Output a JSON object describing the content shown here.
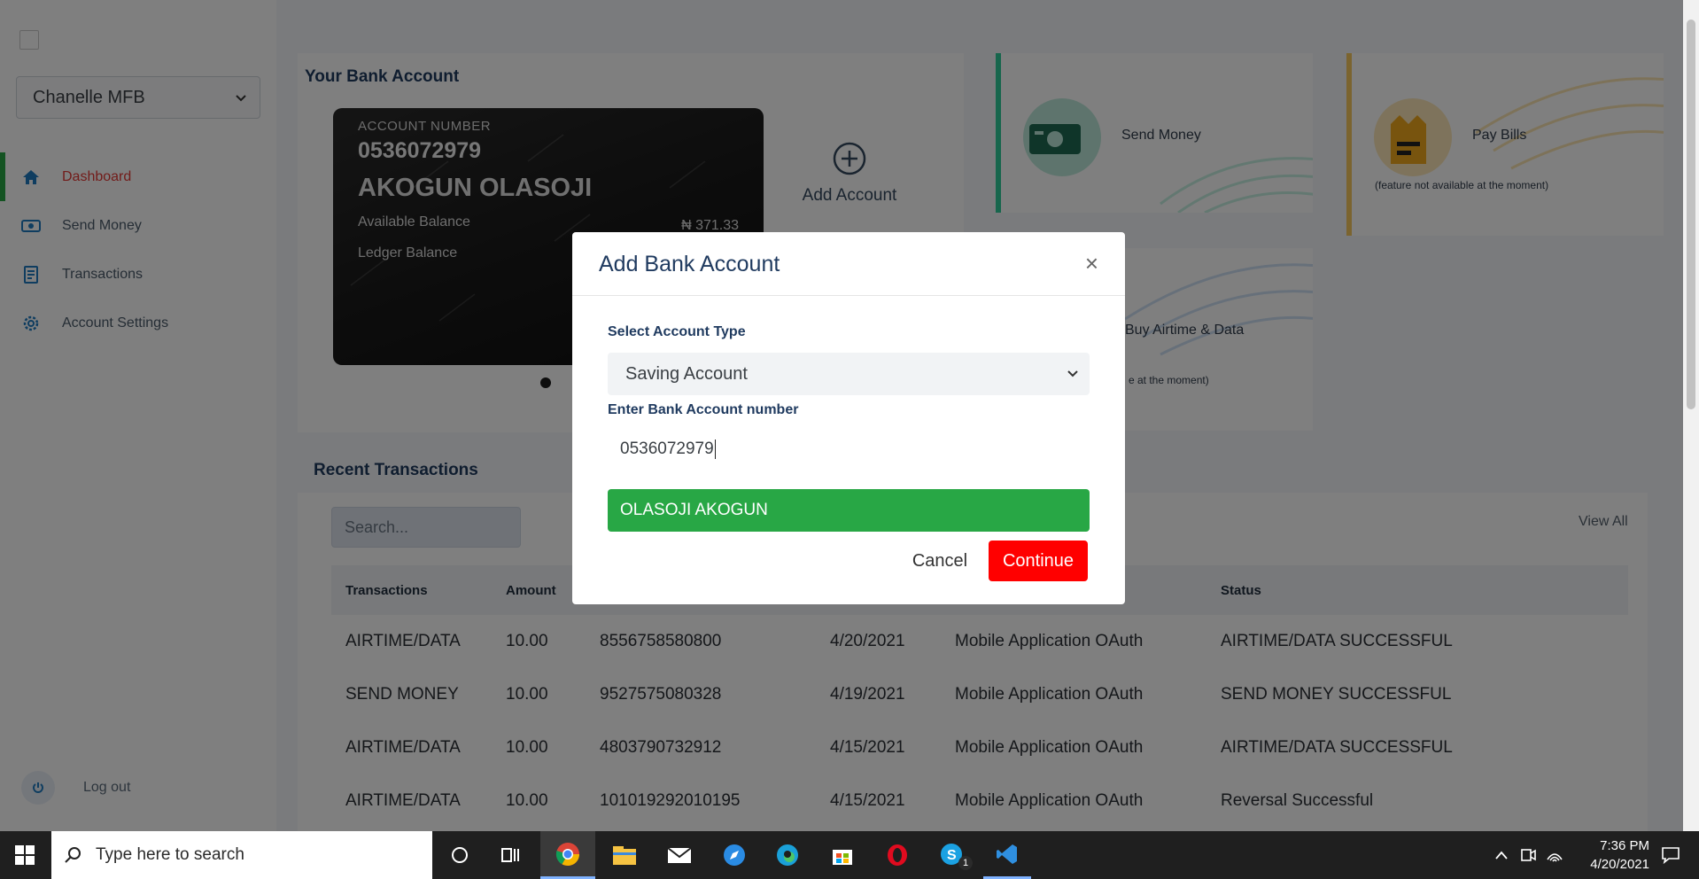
{
  "sidebar": {
    "bank_select": "Chanelle MFB",
    "items": [
      {
        "label": "Dashboard",
        "icon": "home-icon"
      },
      {
        "label": "Send Money",
        "icon": "money-icon"
      },
      {
        "label": "Transactions",
        "icon": "document-icon"
      },
      {
        "label": "Account Settings",
        "icon": "gear-icon"
      }
    ],
    "logout": "Log out"
  },
  "bank_section": {
    "title": "Your Bank Account",
    "card": {
      "account_label": "ACCOUNT NUMBER",
      "account_number": "0536072979",
      "holder_name": "AKOGUN OLASOJI",
      "available_label": "Available Balance",
      "available_value": "₦ 371.33",
      "ledger_label": "Ledger Balance"
    },
    "add_account": "Add Account"
  },
  "tiles": {
    "send_money": "Send Money",
    "pay_bills": "Pay Bills",
    "pay_bills_note": "(feature not available at the moment)",
    "airtime": "Buy Airtime & Data",
    "airtime_note": "e at the moment)"
  },
  "recent": {
    "title": "Recent Transactions",
    "search_placeholder": "Search...",
    "view_all": "View All",
    "headers": {
      "transactions": "Transactions",
      "amount": "Amount",
      "status": "Status"
    },
    "rows": [
      {
        "type": "AIRTIME/DATA",
        "amount": "10.00",
        "ref": "8556758580800",
        "date": "4/20/2021",
        "channel": "Mobile Application OAuth",
        "status": "AIRTIME/DATA SUCCESSFUL"
      },
      {
        "type": "SEND MONEY",
        "amount": "10.00",
        "ref": "9527575080328",
        "date": "4/19/2021",
        "channel": "Mobile Application OAuth",
        "status": "SEND MONEY SUCCESSFUL"
      },
      {
        "type": "AIRTIME/DATA",
        "amount": "10.00",
        "ref": "4803790732912",
        "date": "4/15/2021",
        "channel": "Mobile Application OAuth",
        "status": "AIRTIME/DATA SUCCESSFUL"
      },
      {
        "type": "AIRTIME/DATA",
        "amount": "10.00",
        "ref": "101019292010195",
        "date": "4/15/2021",
        "channel": "Mobile Application OAuth",
        "status": "Reversal Successful"
      }
    ]
  },
  "modal": {
    "title": "Add Bank Account",
    "close": "×",
    "type_label": "Select Account Type",
    "type_value": "Saving Account",
    "number_label": "Enter Bank Account number",
    "number_value": "0536072979",
    "resolved_name": "OLASOJI AKOGUN",
    "cancel": "Cancel",
    "continue": "Continue"
  },
  "taskbar": {
    "search_placeholder": "Type here to search",
    "time": "7:36 PM",
    "date": "4/20/2021",
    "skype_badge": "1"
  },
  "colors": {
    "active_nav": "#e53935",
    "active_indicator": "#28a745",
    "resolved_name_bg": "#28a745",
    "continue_bg": "#ff0000",
    "heading": "#1f3a5f"
  }
}
